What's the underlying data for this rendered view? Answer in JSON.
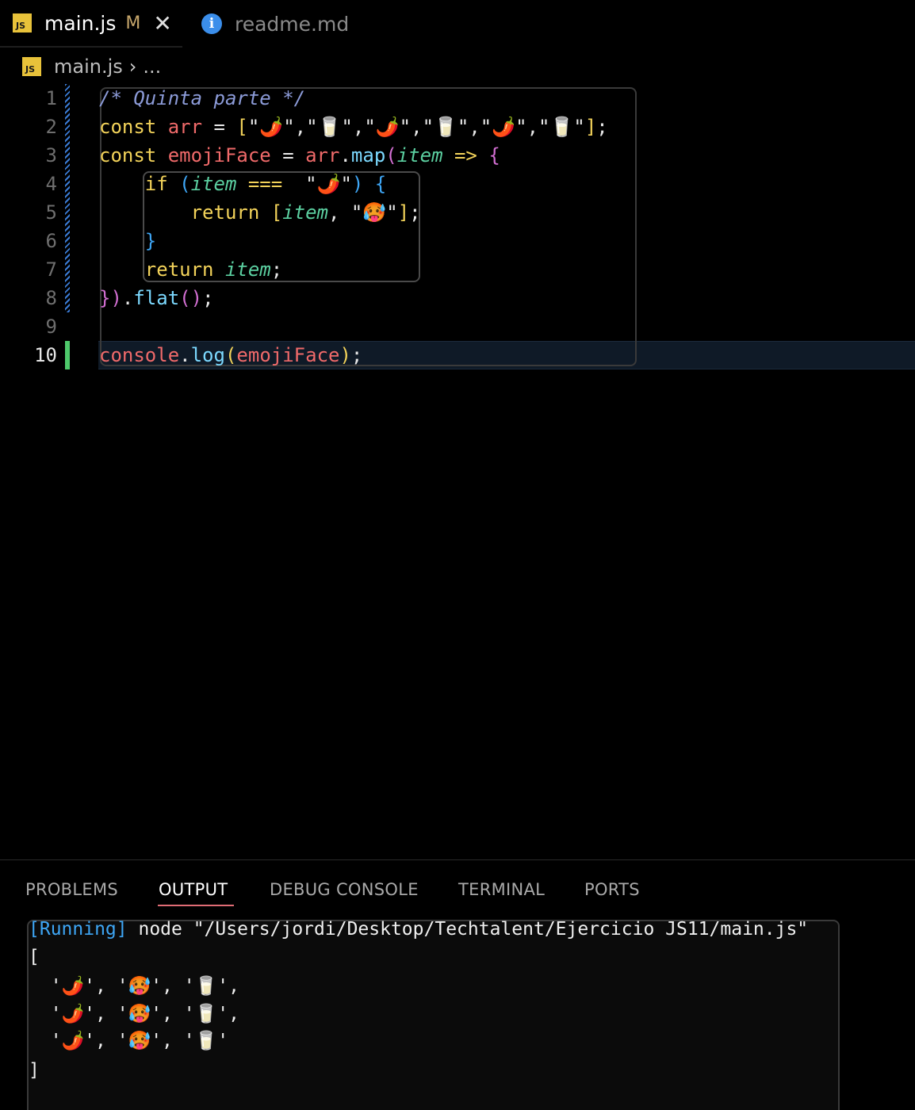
{
  "tabs": [
    {
      "icon": "JS",
      "label": "main.js",
      "status": "M",
      "close": "✕"
    },
    {
      "icon": "i",
      "label": "readme.md"
    }
  ],
  "breadcrumb": {
    "icon": "JS",
    "file": "main.js",
    "separator": "›",
    "more": "..."
  },
  "editor": {
    "line_numbers": [
      "1",
      "2",
      "3",
      "4",
      "5",
      "6",
      "7",
      "8",
      "9",
      "10"
    ],
    "active_line": "10",
    "lines": [
      {
        "comment": "/* Quinta parte */"
      },
      {
        "kw": "const",
        "var": "arr",
        "eq": " = ",
        "open": "[",
        "q1": "\"🌶️\",\"🥛\",\"🌶️\",\"🥛\",\"🌶️\",\"🥛\"",
        "close": "]",
        "semi": ";"
      },
      {
        "kw": "const",
        "var": "emojiFace",
        "eq": " = ",
        "obj": "arr",
        "dot": ".",
        "fn": "map",
        "p1": "(",
        "param": "item",
        "arrow": " => ",
        "b": "{"
      },
      {
        "kw": "if",
        "p1": "(",
        "param": "item",
        "op": " === ",
        "str": "\"🌶️\"",
        "p2": ")",
        "b": "{"
      },
      {
        "kw": "return",
        "open": "[",
        "param": "item",
        "comma": ", ",
        "str": "\"🥵\"",
        "close": "]",
        "semi": ";"
      },
      {
        "b": "}"
      },
      {
        "kw": "return",
        "param": "item",
        "semi": ";"
      },
      {
        "b": "}",
        "p": ")",
        "dot": ".",
        "fn": "flat",
        "call": "()",
        "semi": ";"
      },
      {},
      {
        "obj": "console",
        "dot": ".",
        "fn": "log",
        "p1": "(",
        "var": "emojiFace",
        "p2": ")",
        "semi": ";"
      }
    ]
  },
  "panel": {
    "tabs": [
      "PROBLEMS",
      "OUTPUT",
      "DEBUG CONSOLE",
      "TERMINAL",
      "PORTS"
    ],
    "active_tab": "OUTPUT",
    "output": {
      "running": "[Running]",
      "command": " node \"/Users/jordi/Desktop/Techtalent/Ejercicio JS11/main.js\"",
      "lines": [
        "[",
        "  '🌶️', '🥵', '🥛',",
        "  '🌶️', '🥵', '🥛',",
        "  '🌶️', '🥵', '🥛'",
        "]"
      ]
    }
  }
}
